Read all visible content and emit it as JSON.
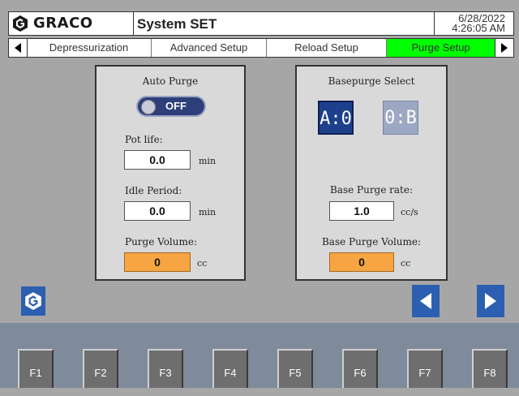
{
  "header": {
    "brand": "GRACO",
    "title": "System SET",
    "date": "6/28/2022",
    "time": "4:26:05 AM"
  },
  "tabs": [
    {
      "label": "Depressurization",
      "active": false
    },
    {
      "label": "Advanced Setup",
      "active": false
    },
    {
      "label": "Reload Setup",
      "active": false
    },
    {
      "label": "Purge Setup",
      "active": true
    }
  ],
  "left_panel": {
    "auto_purge_label": "Auto Purge",
    "toggle_state": "OFF",
    "pot_life_label": "Pot life:",
    "pot_life_value": "0.0",
    "pot_life_unit": "min",
    "idle_period_label": "Idle Period:",
    "idle_period_value": "0.0",
    "idle_period_unit": "min",
    "purge_volume_label": "Purge Volume:",
    "purge_volume_value": "0",
    "purge_volume_unit": "cc"
  },
  "right_panel": {
    "basepurge_select_label": "Basepurge Select",
    "option_a": "A:0",
    "option_b": "0:B",
    "base_purge_rate_label": "Base Purge rate:",
    "base_purge_rate_value": "1.0",
    "base_purge_rate_unit": "cc/s",
    "base_purge_volume_label": "Base Purge Volume:",
    "base_purge_volume_value": "0",
    "base_purge_volume_unit": "cc"
  },
  "function_keys": [
    "F1",
    "F2",
    "F3",
    "F4",
    "F5",
    "F6",
    "F7",
    "F8"
  ],
  "colors": {
    "active_tab": "#00ff00",
    "orange_field": "#f7a442",
    "selected_button": "#1d3f8c",
    "nav_blue": "#2c5fb0"
  }
}
